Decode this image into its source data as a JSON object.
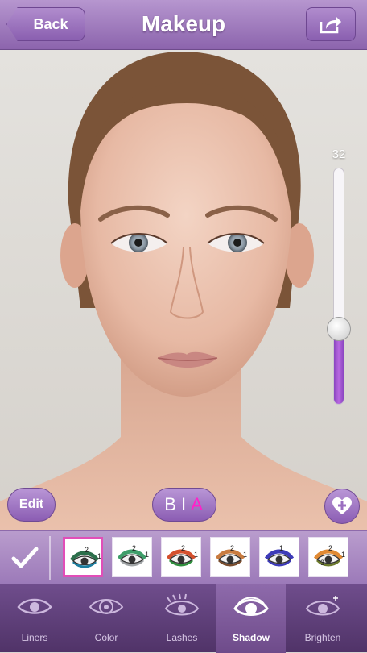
{
  "header": {
    "title": "Makeup",
    "back_label": "Back"
  },
  "slider": {
    "value_label": "32",
    "level": 0.32
  },
  "actions": {
    "edit_label": "Edit",
    "before_label": "B",
    "separator": "I",
    "after_label": "A"
  },
  "presets": {
    "selected_index": 0,
    "items": [
      {
        "numbers": [
          "2",
          "1"
        ],
        "colors": [
          "#2c6f4b",
          "#1d7fa0"
        ]
      },
      {
        "numbers": [
          "2",
          "1"
        ],
        "colors": [
          "#3f9e6a",
          "#a1a5a7"
        ]
      },
      {
        "numbers": [
          "2",
          "1"
        ],
        "colors": [
          "#d4502d",
          "#2f8f3d"
        ]
      },
      {
        "numbers": [
          "2",
          "1"
        ],
        "colors": [
          "#c97c40",
          "#7a4d2e"
        ]
      },
      {
        "numbers": [
          "1"
        ],
        "colors": [
          "#3d3bb8",
          "#3d3bb8"
        ]
      },
      {
        "numbers": [
          "2",
          "1",
          "3"
        ],
        "colors": [
          "#e08a34",
          "#6c7a2c"
        ]
      }
    ]
  },
  "tabs": [
    {
      "label": "Liners",
      "icon": "eye-liner-icon",
      "active": false
    },
    {
      "label": "Color",
      "icon": "eye-color-icon",
      "active": false
    },
    {
      "label": "Lashes",
      "icon": "eye-lashes-icon",
      "active": false
    },
    {
      "label": "Shadow",
      "icon": "eye-shadow-icon",
      "active": true
    },
    {
      "label": "Brighten",
      "icon": "eye-brighten-icon",
      "active": false
    }
  ],
  "colors": {
    "accent": "#8c64ad",
    "selected_border": "#e14eb8",
    "after_accent": "#ff22c8"
  }
}
